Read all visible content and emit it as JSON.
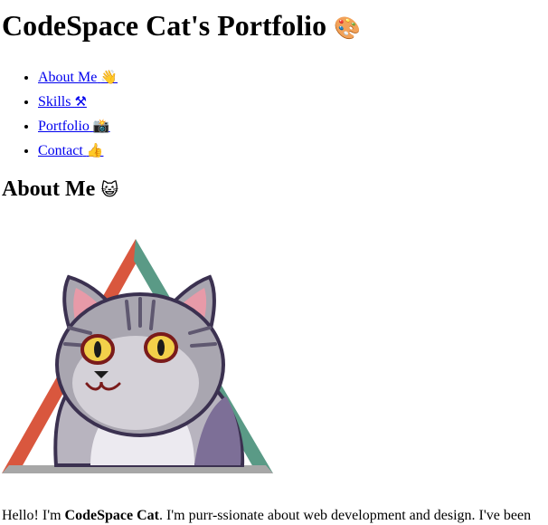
{
  "page": {
    "title": "CodeSpace Cat's Portfolio",
    "title_emoji": "🎨"
  },
  "nav": {
    "items": [
      {
        "label": "About Me",
        "emoji": "👋"
      },
      {
        "label": "Skills",
        "emoji": "⚒"
      },
      {
        "label": "Portfolio",
        "emoji": "📸"
      },
      {
        "label": "Contact",
        "emoji": "👍"
      }
    ]
  },
  "about": {
    "heading": "About Me",
    "heading_emoji": "😺",
    "intro_prefix": "Hello! I'm ",
    "intro_name": "CodeSpace Cat",
    "intro_rest": ". I'm purr-ssionate about web development and design. I've been"
  },
  "colors": {
    "link": "#0000ee",
    "triangle_left": "#d9573e",
    "triangle_right": "#5a9a86",
    "triangle_base": "#a7a7a7",
    "cat_fur": "#a9a6b0",
    "cat_eye": "#f2d04a"
  }
}
